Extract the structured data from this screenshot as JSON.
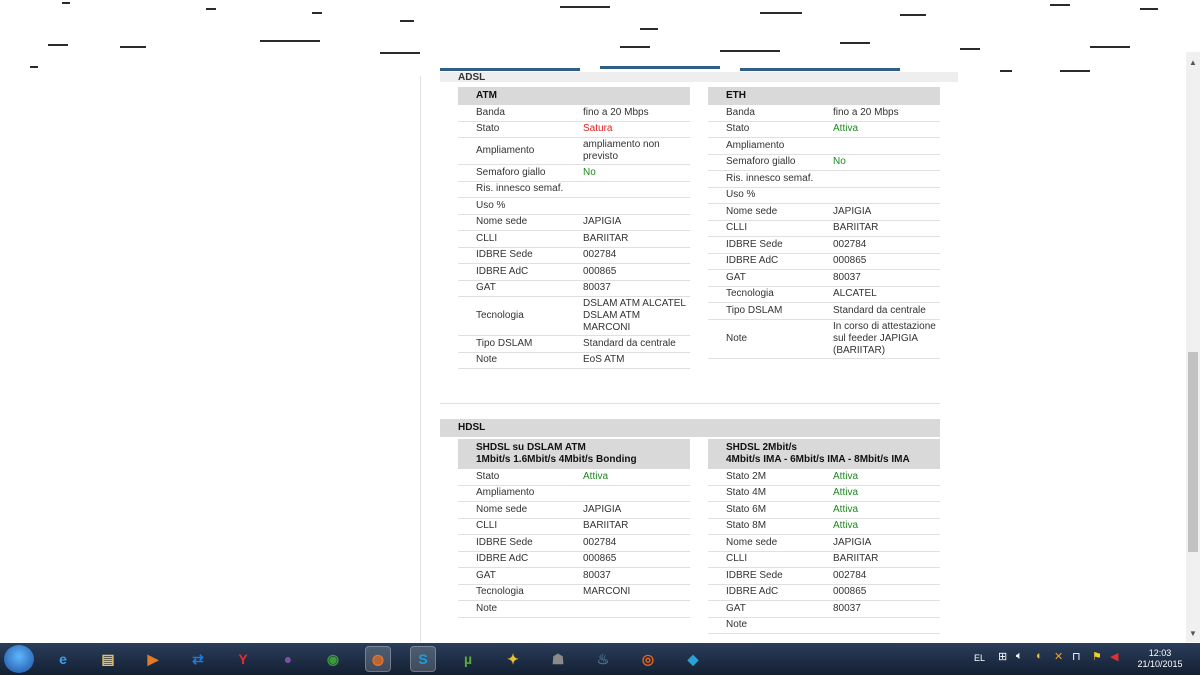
{
  "cut_section": {
    "title": "ADSL"
  },
  "atm": {
    "title": "ATM",
    "rows": [
      {
        "k": "Banda",
        "v": "fino a 20 Mbps",
        "c": ""
      },
      {
        "k": "Stato",
        "v": "Satura",
        "c": "red"
      },
      {
        "k": "Ampliamento",
        "v": "ampliamento non previsto",
        "c": ""
      },
      {
        "k": "Semaforo giallo",
        "v": "No",
        "c": "green"
      },
      {
        "k": "Ris. innesco semaf.",
        "v": "",
        "c": ""
      },
      {
        "k": "Uso %",
        "v": "",
        "c": ""
      },
      {
        "k": "Nome sede",
        "v": "JAPIGIA",
        "c": ""
      },
      {
        "k": "CLLI",
        "v": "BARIITAR",
        "c": ""
      },
      {
        "k": "IDBRE Sede",
        "v": "002784",
        "c": ""
      },
      {
        "k": "IDBRE AdC",
        "v": "000865",
        "c": ""
      },
      {
        "k": "GAT",
        "v": "80037",
        "c": ""
      },
      {
        "k": "Tecnologia",
        "v": "DSLAM ATM ALCATEL DSLAM ATM MARCONI",
        "c": ""
      },
      {
        "k": "Tipo DSLAM",
        "v": "Standard da centrale",
        "c": ""
      },
      {
        "k": "Note",
        "v": "EoS ATM",
        "c": ""
      }
    ]
  },
  "eth": {
    "title": "ETH",
    "rows": [
      {
        "k": "Banda",
        "v": "fino a 20 Mbps",
        "c": ""
      },
      {
        "k": "Stato",
        "v": "Attiva",
        "c": "green"
      },
      {
        "k": "Ampliamento",
        "v": "",
        "c": ""
      },
      {
        "k": "Semaforo giallo",
        "v": "No",
        "c": "green"
      },
      {
        "k": "Ris. innesco semaf.",
        "v": "",
        "c": ""
      },
      {
        "k": "Uso %",
        "v": "",
        "c": ""
      },
      {
        "k": "Nome sede",
        "v": "JAPIGIA",
        "c": ""
      },
      {
        "k": "CLLI",
        "v": "BARIITAR",
        "c": ""
      },
      {
        "k": "IDBRE Sede",
        "v": "002784",
        "c": ""
      },
      {
        "k": "IDBRE AdC",
        "v": "000865",
        "c": ""
      },
      {
        "k": "GAT",
        "v": "80037",
        "c": ""
      },
      {
        "k": "Tecnologia",
        "v": "ALCATEL",
        "c": ""
      },
      {
        "k": "Tipo DSLAM",
        "v": "Standard da centrale",
        "c": ""
      },
      {
        "k": "Note",
        "v": "In corso di attestazione sul feeder JAPIGIA (BARIITAR)",
        "c": ""
      }
    ]
  },
  "hdsl": {
    "title": "HDSL",
    "left": {
      "title_line1": "SHDSL su DSLAM ATM",
      "title_line2": "1Mbit/s 1.6Mbit/s 4Mbit/s Bonding",
      "rows": [
        {
          "k": "Stato",
          "v": "Attiva",
          "c": "green"
        },
        {
          "k": "Ampliamento",
          "v": "",
          "c": ""
        },
        {
          "k": "Nome sede",
          "v": "JAPIGIA",
          "c": ""
        },
        {
          "k": "CLLI",
          "v": "BARIITAR",
          "c": ""
        },
        {
          "k": "IDBRE Sede",
          "v": "002784",
          "c": ""
        },
        {
          "k": "IDBRE AdC",
          "v": "000865",
          "c": ""
        },
        {
          "k": "GAT",
          "v": "80037",
          "c": ""
        },
        {
          "k": "Tecnologia",
          "v": "MARCONI",
          "c": ""
        },
        {
          "k": "Note",
          "v": "",
          "c": ""
        }
      ]
    },
    "right": {
      "title_line1": "SHDSL 2Mbit/s",
      "title_line2": "4Mbit/s IMA - 6Mbit/s IMA - 8Mbit/s IMA",
      "rows": [
        {
          "k": "Stato 2M",
          "v": "Attiva",
          "c": "green"
        },
        {
          "k": "Stato 4M",
          "v": "Attiva",
          "c": "green"
        },
        {
          "k": "Stato 6M",
          "v": "Attiva",
          "c": "green"
        },
        {
          "k": "Stato 8M",
          "v": "Attiva",
          "c": "green"
        },
        {
          "k": "Nome sede",
          "v": "JAPIGIA",
          "c": ""
        },
        {
          "k": "CLLI",
          "v": "BARIITAR",
          "c": ""
        },
        {
          "k": "IDBRE Sede",
          "v": "002784",
          "c": ""
        },
        {
          "k": "IDBRE AdC",
          "v": "000865",
          "c": ""
        },
        {
          "k": "GAT",
          "v": "80037",
          "c": ""
        },
        {
          "k": "Note",
          "v": "",
          "c": ""
        }
      ]
    }
  },
  "taskbar": {
    "icons": [
      {
        "name": "internet-explorer-icon",
        "glyph": "e",
        "color": "#3aa0e8",
        "active": false
      },
      {
        "name": "file-explorer-icon",
        "glyph": "▤",
        "color": "#e8c15a",
        "active": false
      },
      {
        "name": "media-player-icon",
        "glyph": "▶",
        "color": "#e07b2a",
        "active": false
      },
      {
        "name": "teamviewer-icon",
        "glyph": "⇄",
        "color": "#1f7ad6",
        "active": false
      },
      {
        "name": "yandex-browser-icon",
        "glyph": "Y",
        "color": "#e52b2b",
        "active": false
      },
      {
        "name": "tor-browser-icon",
        "glyph": "●",
        "color": "#7d4fa8",
        "active": false
      },
      {
        "name": "chrome-icon",
        "glyph": "◉",
        "color": "#3b9a3b",
        "active": false
      },
      {
        "name": "firefox-icon",
        "glyph": "◍",
        "color": "#e6722a",
        "active": true
      },
      {
        "name": "skype-icon",
        "glyph": "S",
        "color": "#16a0e0",
        "active": true
      },
      {
        "name": "utorrent-icon",
        "glyph": "µ",
        "color": "#5aa83a",
        "active": false
      },
      {
        "name": "puzzle-app-icon",
        "glyph": "✦",
        "color": "#e8c230",
        "active": false
      },
      {
        "name": "game-app-icon",
        "glyph": "☗",
        "color": "#8a8a8a",
        "active": false
      },
      {
        "name": "steam-icon",
        "glyph": "♨",
        "color": "#4a6b8a",
        "active": false
      },
      {
        "name": "origin-icon",
        "glyph": "◎",
        "color": "#e8641e",
        "active": false
      },
      {
        "name": "kodi-icon",
        "glyph": "◆",
        "color": "#2aa0d6",
        "active": false
      }
    ],
    "tray": {
      "language": "EL",
      "time": "12:03",
      "date": "21/10/2015"
    }
  }
}
